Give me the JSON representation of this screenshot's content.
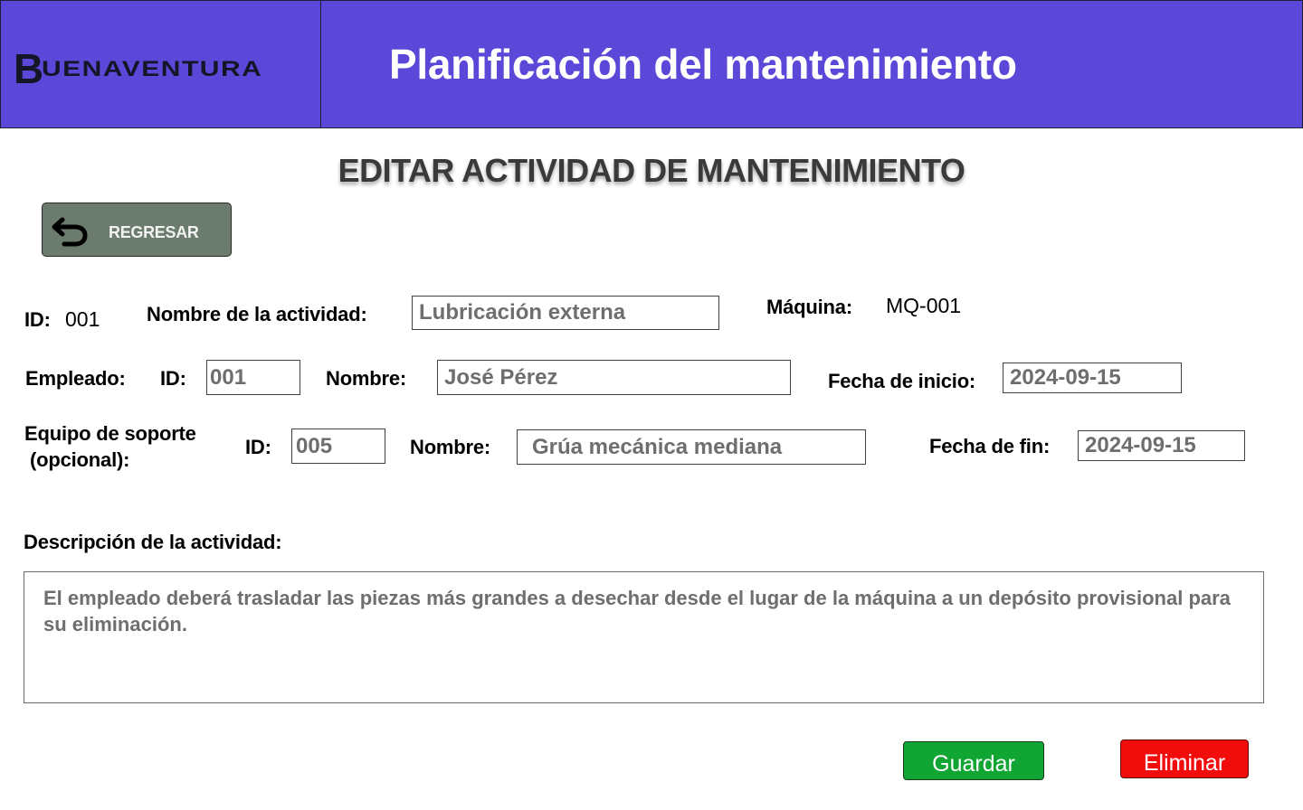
{
  "header": {
    "logo_initial": "B",
    "logo_rest": "UENAVENTURA",
    "app_title": "Planificación del mantenimiento",
    "background": "#5b48d9"
  },
  "page_title": "EDITAR ACTIVIDAD DE MANTENIMIENTO",
  "back_button": {
    "label": "REGRESAR",
    "icon": "undo-arrow-icon",
    "background": "#6b7b6d"
  },
  "activity": {
    "id_label": "ID:",
    "id_value": "001",
    "name_label": "Nombre de la actividad:",
    "name_value": "Lubricación externa",
    "machine_label": "Máquina:",
    "machine_value": "MQ-001"
  },
  "employee": {
    "section_label": "Empleado:",
    "id_label": "ID:",
    "id_value": "001",
    "name_label": "Nombre:",
    "name_value": "José Pérez"
  },
  "start_date": {
    "label": "Fecha de inicio:",
    "value": "2024-09-15"
  },
  "support": {
    "section_label_line1": "Equipo de soporte",
    "section_label_line2": "(opcional):",
    "id_label": "ID:",
    "id_value": "005",
    "name_label": "Nombre:",
    "name_value": "Grúa mecánica mediana"
  },
  "end_date": {
    "label": "Fecha de fin:",
    "value": "2024-09-15"
  },
  "description": {
    "label": "Descripción de la actividad:",
    "value": "El empleado deberá trasladar las piezas más grandes a desechar desde el lugar de la máquina a un depósito provisional para su eliminación."
  },
  "actions": {
    "save_label": "Guardar",
    "save_color": "#11a534",
    "delete_label": "Eliminar",
    "delete_color": "#f20d0d"
  }
}
